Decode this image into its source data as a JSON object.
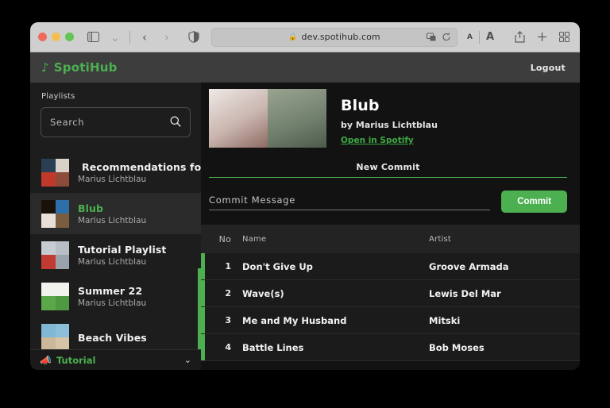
{
  "browser": {
    "url": "dev.spotihub.com",
    "lock_icon": "lock-icon",
    "sidebar_toggle_icon": "sidebar-toggle-icon",
    "chevron_down_icon": "chevron-down-icon",
    "back_icon": "back-arrow-icon",
    "forward_icon": "forward-arrow-icon",
    "shield_icon": "shield-icon",
    "extension_icon": "extension-icon",
    "reload_icon": "reload-icon",
    "text_size_small": "A",
    "text_size_large": "A",
    "share_icon": "share-icon",
    "new_tab_icon": "plus-icon",
    "tab_overview_icon": "tab-grid-icon"
  },
  "app": {
    "brand": "SpotiHub",
    "brand_icon": "music-note-icon",
    "logout_label": "Logout",
    "accent_color": "#4caf50"
  },
  "sidebar": {
    "section_label": "Playlists",
    "search": {
      "placeholder": "Search",
      "icon": "search-icon",
      "value": ""
    },
    "playlists": [
      {
        "name": "Recommendations for you",
        "owner": "Marius Lichtblau",
        "has_dot": true,
        "selected": false,
        "thumb": [
          "#2b3f52",
          "#d9d2c8",
          "#c0392b",
          "#8e4b3a"
        ]
      },
      {
        "name": "Blub",
        "owner": "Marius Lichtblau",
        "has_dot": false,
        "selected": true,
        "thumb": [
          "#1a1208",
          "#2d6fa8",
          "#e8e0d8",
          "#7a5c3e"
        ]
      },
      {
        "name": "Tutorial Playlist",
        "owner": "Marius Lichtblau",
        "has_dot": false,
        "selected": false,
        "thumb": [
          "#c7ccd4",
          "#b9bec6",
          "#c23b33",
          "#9aa2ab"
        ]
      },
      {
        "name": "Summer 22",
        "owner": "Marius Lichtblau",
        "has_dot": false,
        "selected": false,
        "thumb": [
          "#f2f2ee",
          "#f2f2ee",
          "#5aa84a",
          "#4f9a41"
        ]
      },
      {
        "name": "Beach Vibes",
        "owner": "",
        "has_dot": false,
        "selected": false,
        "thumb": [
          "#7fb7d4",
          "#8cc0da",
          "#cbb89a",
          "#d6c4a6"
        ]
      }
    ],
    "tutorial": {
      "label": "Tutorial",
      "icon": "megaphone-icon",
      "chevron": "chevron-down-icon"
    }
  },
  "main": {
    "playlist_title": "Blub",
    "playlist_by": "by Marius Lichtblau",
    "open_link": "Open in Spotify",
    "hero_art": [
      "#e4dcd8",
      "#7e8d7a"
    ],
    "commit": {
      "section_title": "New Commit",
      "message_placeholder": "Commit Message",
      "message_value": "",
      "button_label": "Commit"
    },
    "table": {
      "headers": {
        "no": "No",
        "name": "Name",
        "artist": "Artist"
      },
      "rows": [
        {
          "no": "1",
          "name": "Don't Give Up",
          "artist": "Groove Armada"
        },
        {
          "no": "2",
          "name": "Wave(s)",
          "artist": "Lewis Del Mar"
        },
        {
          "no": "3",
          "name": "Me and My Husband",
          "artist": "Mitski"
        },
        {
          "no": "4",
          "name": "Battle Lines",
          "artist": "Bob Moses"
        }
      ]
    }
  }
}
